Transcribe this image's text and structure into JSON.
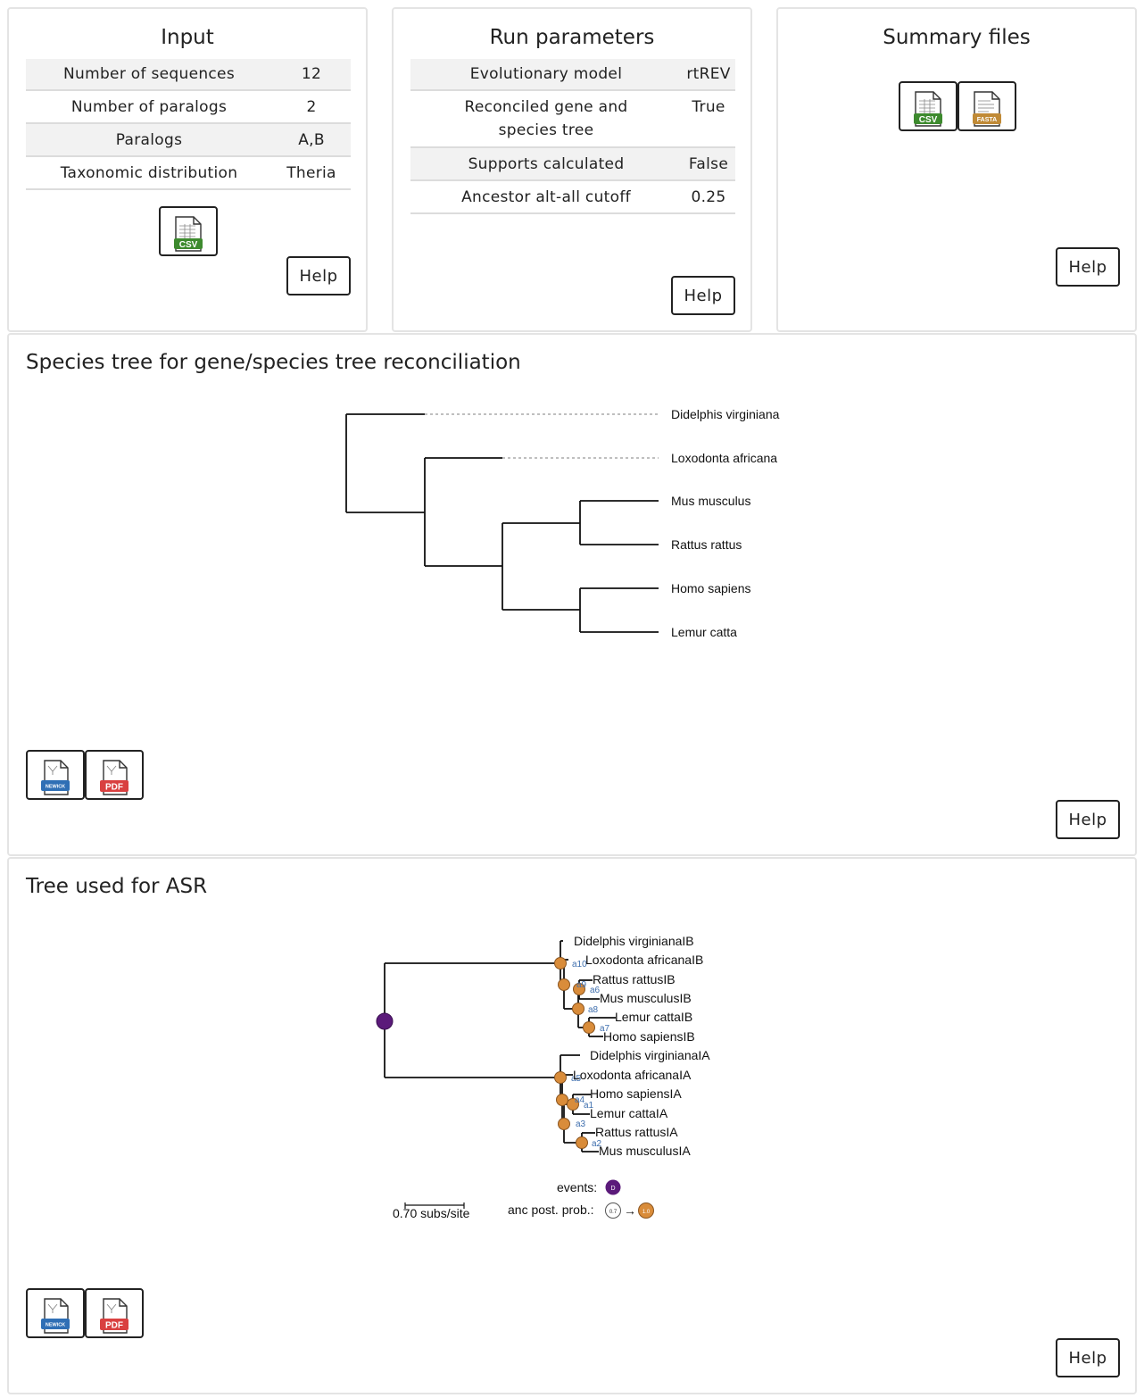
{
  "input_card": {
    "title": "Input",
    "rows": [
      {
        "label": "Number of sequences",
        "value": "12"
      },
      {
        "label": "Number of paralogs",
        "value": "2"
      },
      {
        "label": "Paralogs",
        "value": "A,B"
      },
      {
        "label": "Taxonomic distribution",
        "value": "Theria"
      }
    ],
    "csv_icon": "csv-file-icon",
    "help_label": "Help"
  },
  "run_card": {
    "title": "Run parameters",
    "rows": [
      {
        "label": "Evolutionary model",
        "value": "rtREV"
      },
      {
        "label": "Reconciled gene and species tree",
        "value": "True"
      },
      {
        "label": "Supports calculated",
        "value": "False"
      },
      {
        "label": "Ancestor alt-all cutoff",
        "value": "0.25"
      }
    ],
    "help_label": "Help"
  },
  "summary_card": {
    "title": "Summary files",
    "csv_icon": "csv-file-icon",
    "fasta_icon": "fasta-file-icon",
    "help_label": "Help"
  },
  "species_card": {
    "title": "Species tree for gene/species tree reconciliation",
    "leaves": [
      "Didelphis virginiana",
      "Loxodonta africana",
      "Mus musculus",
      "Rattus rattus",
      "Homo sapiens",
      "Lemur catta"
    ],
    "newick_icon": "newick-file-icon",
    "pdf_icon": "pdf-file-icon",
    "help_label": "Help"
  },
  "asr_card": {
    "title": "Tree used for ASR",
    "leaves": [
      "Didelphis virginianaIB",
      "Loxodonta africanaIB",
      "Rattus rattusIB",
      "Mus musculusIB",
      "Lemur cattaIB",
      "Homo sapiensIB",
      "Didelphis virginianaIA",
      "Loxodonta africanaIA",
      "Homo sapiensIA",
      "Lemur cattaIA",
      "Rattus rattusIA",
      "Mus musculusIA"
    ],
    "node_labels": [
      "a10",
      "a9",
      "a6",
      "a8",
      "a7",
      "a5",
      "a4",
      "a1",
      "a3",
      "a2"
    ],
    "scale_label": "0.70 subs/site",
    "events_label": "events:",
    "event_marker": "D",
    "anc_label": "anc post. prob.:",
    "anc_low": "0.7",
    "anc_arrow": "→",
    "anc_high": "1.0",
    "colors": {
      "duplication": "#5b1a7a",
      "ancestor": "#d98c3a",
      "node_label": "#3f6fae"
    },
    "newick_icon": "newick-file-icon",
    "pdf_icon": "pdf-file-icon",
    "help_label": "Help"
  }
}
